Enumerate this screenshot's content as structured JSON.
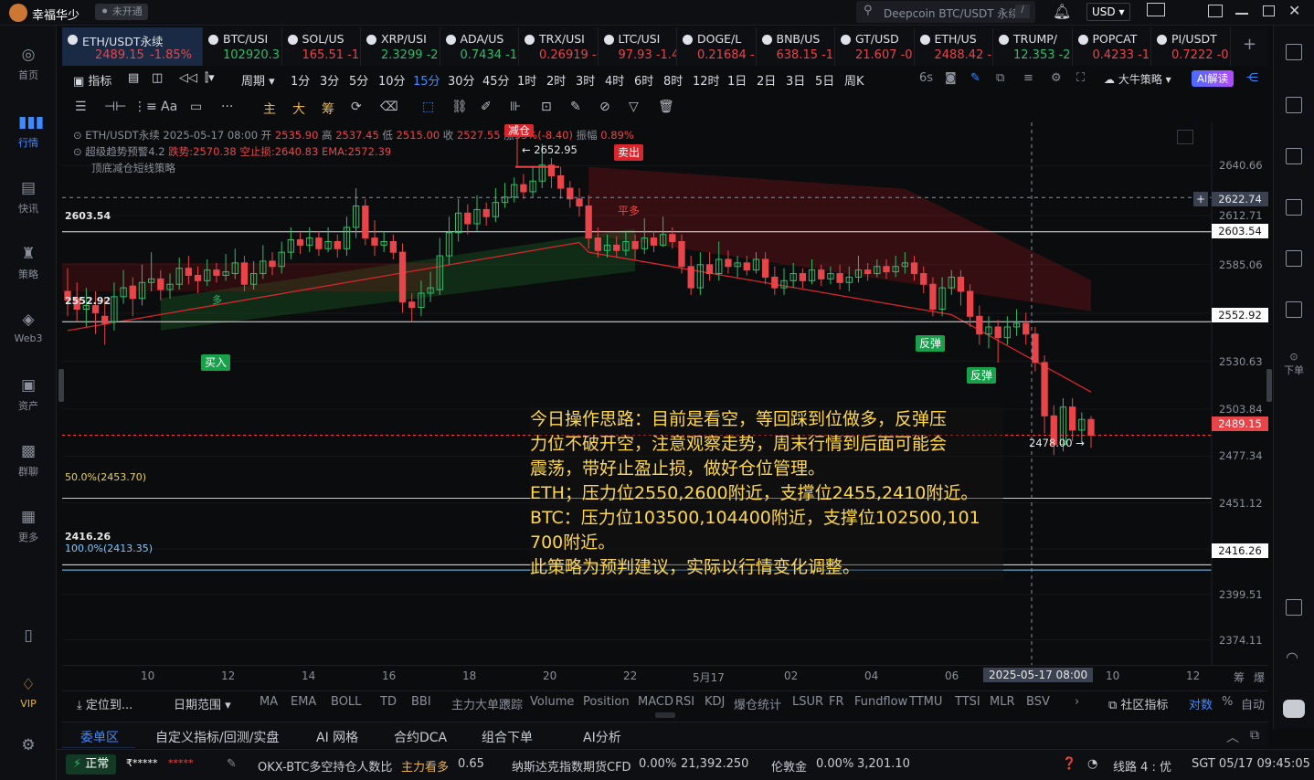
{
  "app": {
    "user": "幸福华少",
    "status": "未开通",
    "search_placeholder": "Deepcoin BTC/USDT 永续",
    "search_key": "/",
    "currency": "USD"
  },
  "sidebar": [
    {
      "label": "首页"
    },
    {
      "label": "行情"
    },
    {
      "label": "快讯"
    },
    {
      "label": "策略"
    },
    {
      "label": "Web3"
    },
    {
      "label": "资产"
    },
    {
      "label": "群聊"
    },
    {
      "label": "更多"
    },
    {
      "label": "VIP"
    }
  ],
  "tickers": [
    {
      "name": "ETH/USDT永续",
      "price": "2489.15",
      "change": "-1.85%",
      "dir": "dn"
    },
    {
      "name": "BTC/USI",
      "price": "102920.3 ·",
      "change": "",
      "dir": "up"
    },
    {
      "name": "SOL/US",
      "price": "165.51 -1.",
      "change": "",
      "dir": "dn"
    },
    {
      "name": "XRP/USI",
      "price": "2.3299 -2.(",
      "change": "",
      "dir": "up"
    },
    {
      "name": "ADA/US",
      "price": "0.7434 -1.",
      "change": "",
      "dir": "up"
    },
    {
      "name": "TRX/USI",
      "price": "0.26919 -(",
      "change": "",
      "dir": "dn"
    },
    {
      "name": "LTC/USI",
      "price": "97.93 -1.4:",
      "change": "",
      "dir": "dn"
    },
    {
      "name": "DOGE/L",
      "price": "0.21684 -1",
      "change": "",
      "dir": "dn"
    },
    {
      "name": "BNB/US",
      "price": "638.15 -1.:",
      "change": "",
      "dir": "dn"
    },
    {
      "name": "GT/USD",
      "price": "21.607 -0.:",
      "change": "",
      "dir": "dn"
    },
    {
      "name": "ETH/US",
      "price": "2488.42 -1",
      "change": "",
      "dir": "dn"
    },
    {
      "name": "TRUMP/",
      "price": "12.353 -2.:",
      "change": "",
      "dir": "up"
    },
    {
      "name": "POPCAT",
      "price": "0.4233 -1.(",
      "change": "",
      "dir": "dn"
    },
    {
      "name": "PI/USDT",
      "price": "0.7222 -0.:",
      "change": "",
      "dir": "dn"
    }
  ],
  "toolbar": {
    "indicator": "指标",
    "period": "周期",
    "timeframes": [
      "1分",
      "3分",
      "5分",
      "10分",
      "15分",
      "30分",
      "45分",
      "1时",
      "2时",
      "3时",
      "4时",
      "6时",
      "8时",
      "12时",
      "1日",
      "2日",
      "3日",
      "5日",
      "周K"
    ],
    "active_tf": "15分",
    "refresh": "6s",
    "strategy": "大牛策略",
    "ai": "AI解读"
  },
  "drawbar": [
    "主",
    "大",
    "筹"
  ],
  "chart_info": {
    "line1": {
      "sym": "ETH/USDT永续",
      "time": "2025-05-17 08:00",
      "open_l": "开",
      "open": "2535.90",
      "high_l": "高",
      "high": "2537.45",
      "low_l": "低",
      "low": "2515.00",
      "close_l": "收",
      "close": "2527.55",
      "chg_l": "涨",
      "chg": "33%(-8.40)",
      "amp_l": "振幅",
      "amp": "0.89%"
    },
    "line2": {
      "name": "超级趋势预警4.2",
      "a": "跌势:2570.38",
      "b": "空止损:2640.83",
      "c": "EMA:2572.39"
    },
    "line3": "顶底减仓短线策略"
  },
  "overlay": [
    "今日操作思路：目前是看空，等回踩到位做多，反弹压",
    "力位不破开空，注意观察走势，周末行情到后面可能会",
    "震荡，带好止盈止损，做好仓位管理。",
    "ETH；压力位2550,2600附近，支撑位2455,2410附近。",
    "BTC：压力位103500,104400附近，支撑位102500,101",
    "700附近。",
    "此策略为预判建议，实际以行情变化调整。"
  ],
  "levels": {
    "l1": "2603.54",
    "l2": "2552.92",
    "l3": "50.0%(2453.70)",
    "l4": "2416.26",
    "l5": "100.0%(2413.35)"
  },
  "annotations": {
    "buy": "买入",
    "sell": "卖出",
    "reduce": "减仓",
    "close_long": "平多",
    "rebound1": "反弹",
    "rebound2": "反弹",
    "long": "多",
    "high_mark": "← 2652.95",
    "low_mark": "2478.00 →"
  },
  "price_axis": {
    "ticks": [
      "2640.66",
      "2612.71",
      "2585.06",
      "2557.70",
      "2530.63",
      "2503.84",
      "2477.34",
      "2451.12",
      "2425.17",
      "2399.51",
      "2374.11"
    ],
    "crosshair": "2622.74",
    "last": "2489.15",
    "box1": "2603.54",
    "box2": "2552.92",
    "box3": "2416.26"
  },
  "time_axis": {
    "labels": [
      "10",
      "12",
      "14",
      "16",
      "18",
      "20",
      "22",
      "5月17",
      "02",
      "04",
      "06",
      "08",
      "10",
      "12"
    ],
    "crosshair": "2025-05-17 08:00",
    "right": [
      "筹",
      "爆"
    ]
  },
  "indicators": {
    "locate": "定位到...",
    "range": "日期范围",
    "list": [
      "MA",
      "EMA",
      "BOLL",
      "TD",
      "BBI",
      "主力大单跟踪"
    ],
    "list2": [
      "Volume",
      "Position",
      "MACD",
      "RSI",
      "KDJ",
      "爆仓统计",
      "LSUR",
      "FR",
      "Fundflow",
      "TTMU",
      "TTSI",
      "MLR",
      "BSV"
    ],
    "community": "社区指标",
    "compare": "对数",
    "pct": "%",
    "auto": "自动"
  },
  "tabs": [
    "委单区",
    "自定义指标/回测/实盘",
    "AI 网格",
    "合约DCA",
    "组合下单",
    "AI分析"
  ],
  "status": {
    "conn": "正常",
    "acct": "₹*****",
    "stars": "*****",
    "pair_ratio": "OKX-BTC多空持仓人数比",
    "pair_label": "主力看多",
    "pair_val": "0.65",
    "nas": "纳斯达克指数期货CFD",
    "nas_chg": "0.00%",
    "nas_val": "21,392.250",
    "gold": "伦敦金",
    "gold_chg": "0.00%",
    "gold_val": "3,201.10",
    "line": "线路 4 : 优",
    "time": "SGT 05/17 09:45:05"
  },
  "chart_data": {
    "type": "candlestick",
    "symbol": "ETH/USDT永续",
    "interval": "15分",
    "ylim": [
      2360,
      2665
    ],
    "candles": [
      [
        2570,
        2565,
        2583,
        2556
      ],
      [
        2566,
        2560,
        2575,
        2553
      ],
      [
        2560,
        2562,
        2572,
        2550
      ],
      [
        2562,
        2558,
        2570,
        2546
      ],
      [
        2556,
        2552,
        2566,
        2540
      ],
      [
        2553,
        2567,
        2575,
        2548
      ],
      [
        2567,
        2572,
        2582,
        2563
      ],
      [
        2573,
        2566,
        2578,
        2556
      ],
      [
        2566,
        2575,
        2585,
        2562
      ],
      [
        2575,
        2577,
        2592,
        2570
      ],
      [
        2577,
        2571,
        2582,
        2565
      ],
      [
        2571,
        2574,
        2580,
        2566
      ],
      [
        2574,
        2583,
        2589,
        2571
      ],
      [
        2583,
        2579,
        2590,
        2574
      ],
      [
        2579,
        2576,
        2584,
        2569
      ],
      [
        2576,
        2582,
        2588,
        2573
      ],
      [
        2582,
        2579,
        2586,
        2575
      ],
      [
        2579,
        2581,
        2591,
        2576
      ],
      [
        2580,
        2586,
        2594,
        2577
      ],
      [
        2586,
        2574,
        2590,
        2570
      ],
      [
        2574,
        2580,
        2587,
        2571
      ],
      [
        2580,
        2587,
        2596,
        2577
      ],
      [
        2587,
        2584,
        2592,
        2579
      ],
      [
        2584,
        2592,
        2598,
        2580
      ],
      [
        2592,
        2599,
        2606,
        2588
      ],
      [
        2599,
        2596,
        2603,
        2591
      ],
      [
        2596,
        2600,
        2606,
        2592
      ],
      [
        2600,
        2594,
        2604,
        2590
      ],
      [
        2594,
        2598,
        2606,
        2592
      ],
      [
        2598,
        2594,
        2602,
        2589
      ],
      [
        2594,
        2606,
        2612,
        2590
      ],
      [
        2606,
        2618,
        2628,
        2600
      ],
      [
        2618,
        2600,
        2622,
        2596
      ],
      [
        2600,
        2596,
        2610,
        2590
      ],
      [
        2596,
        2598,
        2604,
        2592
      ],
      [
        2598,
        2592,
        2602,
        2588
      ],
      [
        2592,
        2564,
        2597,
        2558
      ],
      [
        2564,
        2561,
        2569,
        2553
      ],
      [
        2561,
        2569,
        2576,
        2556
      ],
      [
        2569,
        2572,
        2581,
        2564
      ],
      [
        2571,
        2590,
        2600,
        2568
      ],
      [
        2590,
        2603,
        2612,
        2585
      ],
      [
        2603,
        2614,
        2622,
        2598
      ],
      [
        2614,
        2608,
        2619,
        2602
      ],
      [
        2608,
        2616,
        2624,
        2604
      ],
      [
        2616,
        2612,
        2620,
        2607
      ],
      [
        2612,
        2620,
        2628,
        2609
      ],
      [
        2620,
        2623,
        2631,
        2617
      ],
      [
        2623,
        2630,
        2634,
        2620
      ],
      [
        2630,
        2626,
        2636,
        2622
      ],
      [
        2626,
        2632,
        2640,
        2623
      ],
      [
        2632,
        2641,
        2652.95,
        2628
      ],
      [
        2641,
        2635,
        2645,
        2628
      ],
      [
        2635,
        2628,
        2640,
        2622
      ],
      [
        2628,
        2622,
        2632,
        2617
      ],
      [
        2622,
        2618,
        2628,
        2612
      ],
      [
        2618,
        2600,
        2624,
        2594
      ],
      [
        2600,
        2593,
        2606,
        2589
      ],
      [
        2593,
        2596,
        2602,
        2589
      ],
      [
        2596,
        2593,
        2601,
        2589
      ],
      [
        2593,
        2598,
        2604,
        2590
      ],
      [
        2598,
        2594,
        2602,
        2588
      ],
      [
        2594,
        2600,
        2611,
        2591
      ],
      [
        2600,
        2596,
        2604,
        2592
      ],
      [
        2596,
        2602,
        2612,
        2595
      ],
      [
        2602,
        2598,
        2606,
        2594
      ],
      [
        2598,
        2584,
        2602,
        2580
      ],
      [
        2584,
        2572,
        2590,
        2568
      ],
      [
        2572,
        2585,
        2592,
        2568
      ],
      [
        2585,
        2580,
        2592,
        2576
      ],
      [
        2580,
        2588,
        2598,
        2576
      ],
      [
        2588,
        2584,
        2593,
        2580
      ],
      [
        2584,
        2586,
        2590,
        2578
      ],
      [
        2586,
        2582,
        2590,
        2579
      ],
      [
        2582,
        2588,
        2592,
        2580
      ],
      [
        2588,
        2578,
        2592,
        2574
      ],
      [
        2578,
        2572,
        2584,
        2568
      ],
      [
        2572,
        2576,
        2583,
        2568
      ],
      [
        2576,
        2580,
        2586,
        2572
      ],
      [
        2580,
        2576,
        2583,
        2572
      ],
      [
        2576,
        2582,
        2588,
        2574
      ],
      [
        2582,
        2577,
        2585,
        2573
      ],
      [
        2577,
        2580,
        2584,
        2574
      ],
      [
        2580,
        2575,
        2585,
        2571
      ],
      [
        2575,
        2578,
        2584,
        2570
      ],
      [
        2578,
        2582,
        2590,
        2575
      ],
      [
        2582,
        2580,
        2586,
        2576
      ],
      [
        2580,
        2584,
        2588,
        2578
      ],
      [
        2584,
        2581,
        2588,
        2577
      ],
      [
        2581,
        2584,
        2590,
        2578
      ],
      [
        2584,
        2586,
        2592,
        2580
      ],
      [
        2586,
        2580,
        2590,
        2576
      ],
      [
        2580,
        2574,
        2584,
        2569
      ],
      [
        2574,
        2560,
        2578,
        2556
      ],
      [
        2560,
        2572,
        2578,
        2556
      ],
      [
        2572,
        2578,
        2582,
        2568
      ],
      [
        2578,
        2570,
        2582,
        2562
      ],
      [
        2570,
        2556,
        2574,
        2550
      ],
      [
        2556,
        2546,
        2562,
        2540
      ],
      [
        2546,
        2550,
        2556,
        2538
      ],
      [
        2550,
        2544,
        2554,
        2530
      ],
      [
        2544,
        2550,
        2556,
        2540
      ],
      [
        2550,
        2552,
        2560,
        2545
      ],
      [
        2552,
        2546,
        2558,
        2540
      ],
      [
        2546,
        2530,
        2550,
        2525
      ],
      [
        2530,
        2500,
        2534,
        2490
      ],
      [
        2500,
        2484,
        2506,
        2478
      ],
      [
        2484,
        2505,
        2510,
        2480
      ],
      [
        2505,
        2492,
        2510,
        2486
      ],
      [
        2492,
        2498,
        2502,
        2485
      ],
      [
        2498,
        2489.15,
        2500,
        2482
      ]
    ],
    "price_ticks": [
      2640.66,
      2612.71,
      2585.06,
      2557.7,
      2530.63,
      2503.84,
      2477.34,
      2451.12,
      2425.17,
      2399.51,
      2374.11
    ],
    "horizontal_levels": [
      2603.54,
      2552.92,
      2453.7,
      2416.26,
      2413.35
    ]
  }
}
